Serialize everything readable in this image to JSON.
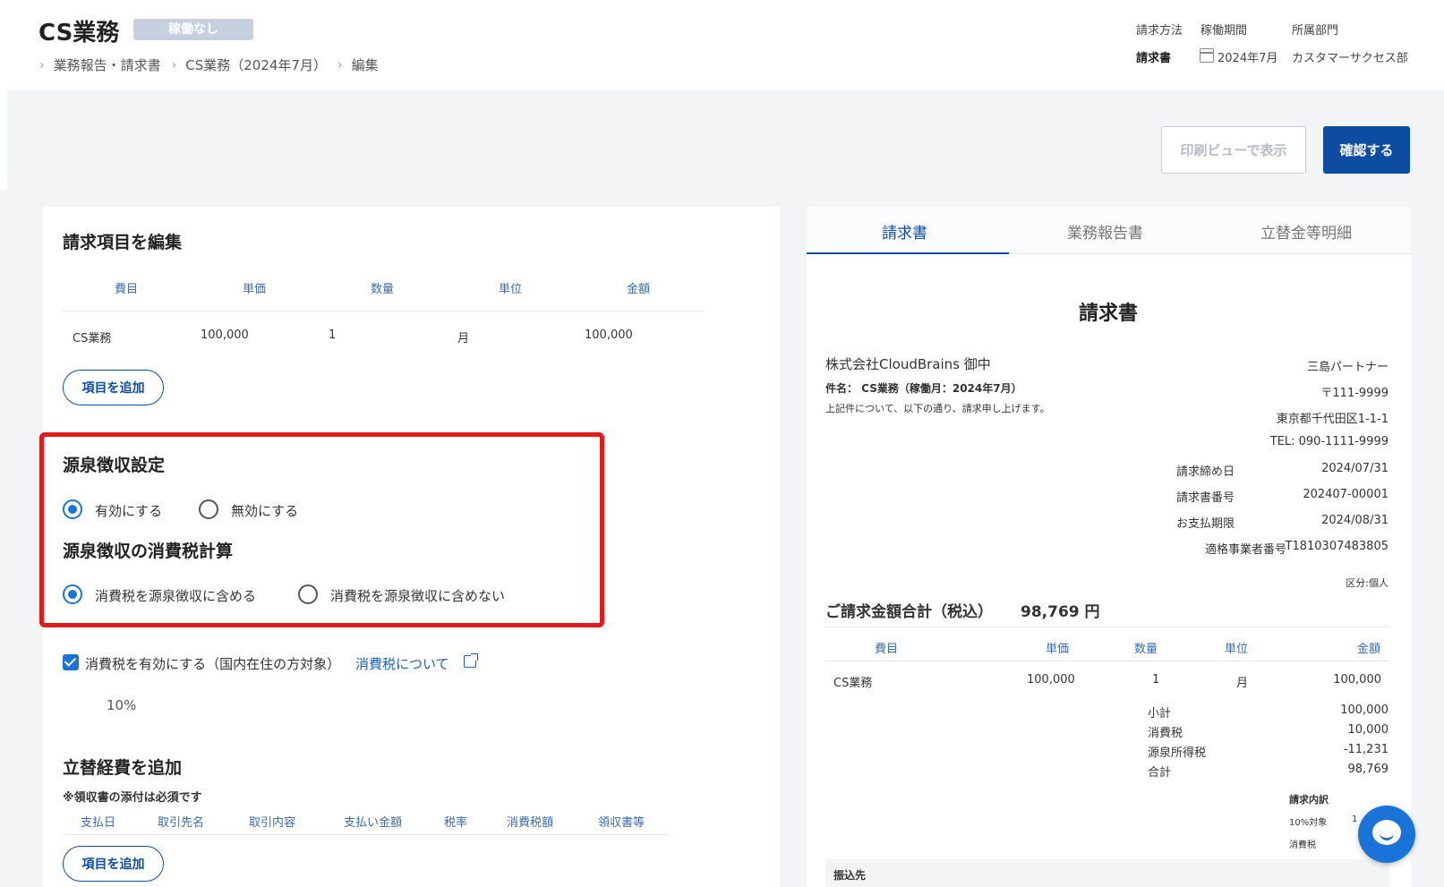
{
  "header": {
    "title": "CS業務",
    "status_badge": "稼働なし",
    "breadcrumb": [
      "業務報告・請求書",
      "CS業務（2024年7月）",
      "編集"
    ],
    "meta": {
      "billing_method_label": "請求方法",
      "billing_method_value": "請求書",
      "period_label": "稼働期間",
      "period_value": "2024年7月",
      "department_label": "所属部門",
      "department_value": "カスタマーサクセス部"
    }
  },
  "actions": {
    "print_label": "印刷ビューで表示",
    "confirm_label": "確認する"
  },
  "billing_items": {
    "title": "請求項目を編集",
    "columns": [
      "費目",
      "単価",
      "数量",
      "単位",
      "金額"
    ],
    "rows": [
      {
        "item": "CS業務",
        "unit_price": "100,000",
        "quantity": "1",
        "unit": "月",
        "amount": "100,000"
      }
    ],
    "add_label": "項目を追加"
  },
  "withholding": {
    "title": "源泉徴収設定",
    "enable_label": "有効にする",
    "disable_label": "無効にする",
    "tax_calc_title": "源泉徴収の消費税計算",
    "include_label": "消費税を源泉徴収に含める",
    "exclude_label": "消費税を源泉徴収に含めない"
  },
  "consumption_tax": {
    "checkbox_label": "消費税を有効にする（国内在住の方対象）",
    "link_label": "消費税について",
    "rate": "10%"
  },
  "expenses": {
    "title": "立替経費を追加",
    "note": "※領収書の添付は必須です",
    "columns": [
      "支払日",
      "取引先名",
      "取引内容",
      "支払い金額",
      "税率",
      "消費税額",
      "領収書等"
    ],
    "add_label": "項目を追加"
  },
  "tabs": [
    "請求書",
    "業務報告書",
    "立替金等明細"
  ],
  "invoice": {
    "title": "請求書",
    "client": "株式会社CloudBrains 御中",
    "subject": "件名： CS業務（稼働月：2024年7月）",
    "intro": "上記件について、以下の通り、請求申し上げます。",
    "issuer_name": "三島パートナー",
    "issuer_postal": "〒111-9999",
    "issuer_address": "東京都千代田区1-1-1",
    "issuer_tel": "TEL: 090-1111-9999",
    "closing_label": "請求締め日",
    "closing_value": "2024/07/31",
    "number_label": "請求書番号",
    "number_value": "202407-00001",
    "due_label": "お支払期限",
    "due_value": "2024/08/31",
    "registration_label": "適格事業者番号",
    "registration_value": "T1810307483805",
    "category": "区分:個人",
    "total_label": "ご請求金額合計（税込）",
    "total_value": "98,769 円",
    "columns": [
      "費目",
      "単価",
      "数量",
      "単位",
      "金額"
    ],
    "row": {
      "item": "CS業務",
      "unit_price": "100,000",
      "quantity": "1",
      "unit": "月",
      "amount": "100,000"
    },
    "subtotal_label": "小計",
    "subtotal_value": "100,000",
    "tax_label": "消費税",
    "tax_value": "10,000",
    "withholding_label": "源泉所得税",
    "withholding_value": "-11,231",
    "grand_label": "合計",
    "grand_value": "98,769",
    "breakdown_title": "請求内訳",
    "breakdown_taxable": "10%対象",
    "breakdown_taxable_value": "1",
    "breakdown_tax": "消費税",
    "bank_title": "振込先"
  },
  "colors": {
    "primary": "#0c4da2",
    "accent": "#1a73d9",
    "highlight": "#e01b1b"
  }
}
